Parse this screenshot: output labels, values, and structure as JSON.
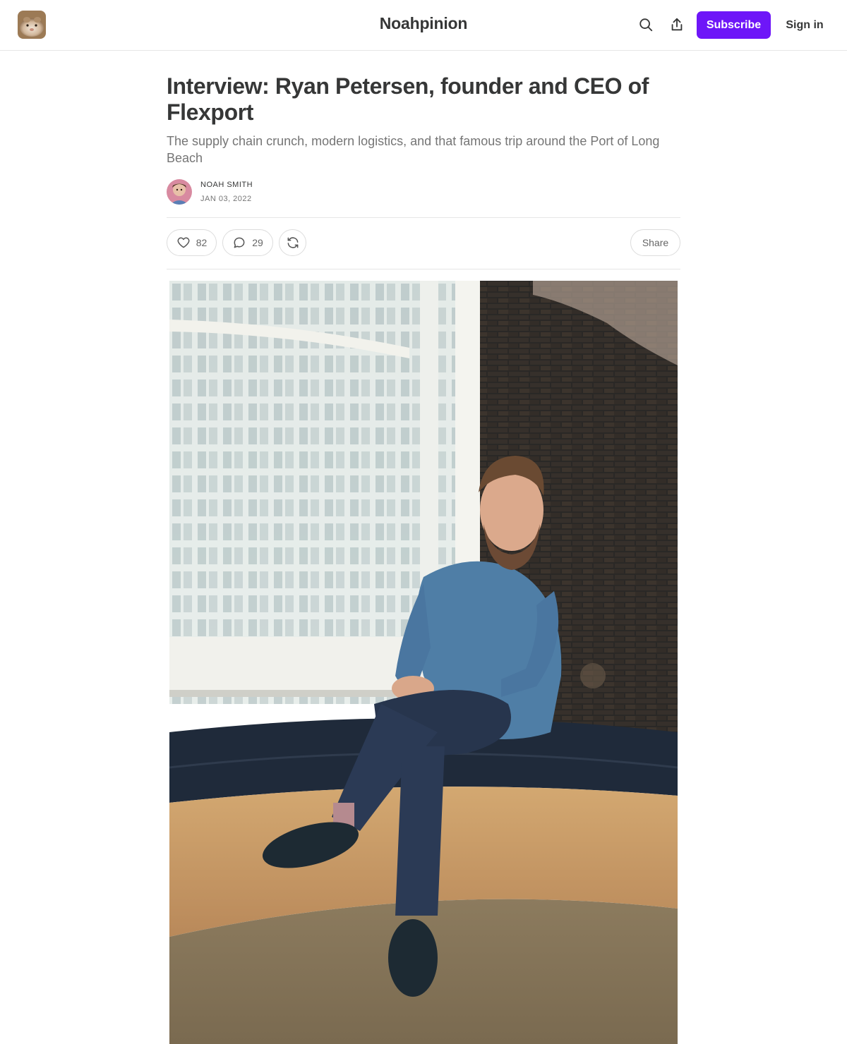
{
  "header": {
    "publication": "Noahpinion",
    "subscribe_label": "Subscribe",
    "signin_label": "Sign in",
    "icons": [
      "search-icon",
      "share-upload-icon"
    ]
  },
  "post": {
    "title": "Interview: Ryan Petersen, founder and CEO of Flexport",
    "subtitle": "The supply chain crunch, modern logistics, and that famous trip around the Port of Long Beach",
    "author": "NOAH SMITH",
    "date": "JAN 03, 2022"
  },
  "actions": {
    "likes": "82",
    "comments": "29",
    "share_label": "Share",
    "icons": [
      "heart-icon",
      "comment-icon",
      "restack-icon"
    ]
  },
  "colors": {
    "accent": "#6e16f8",
    "text": "#363737",
    "muted": "#757575"
  }
}
